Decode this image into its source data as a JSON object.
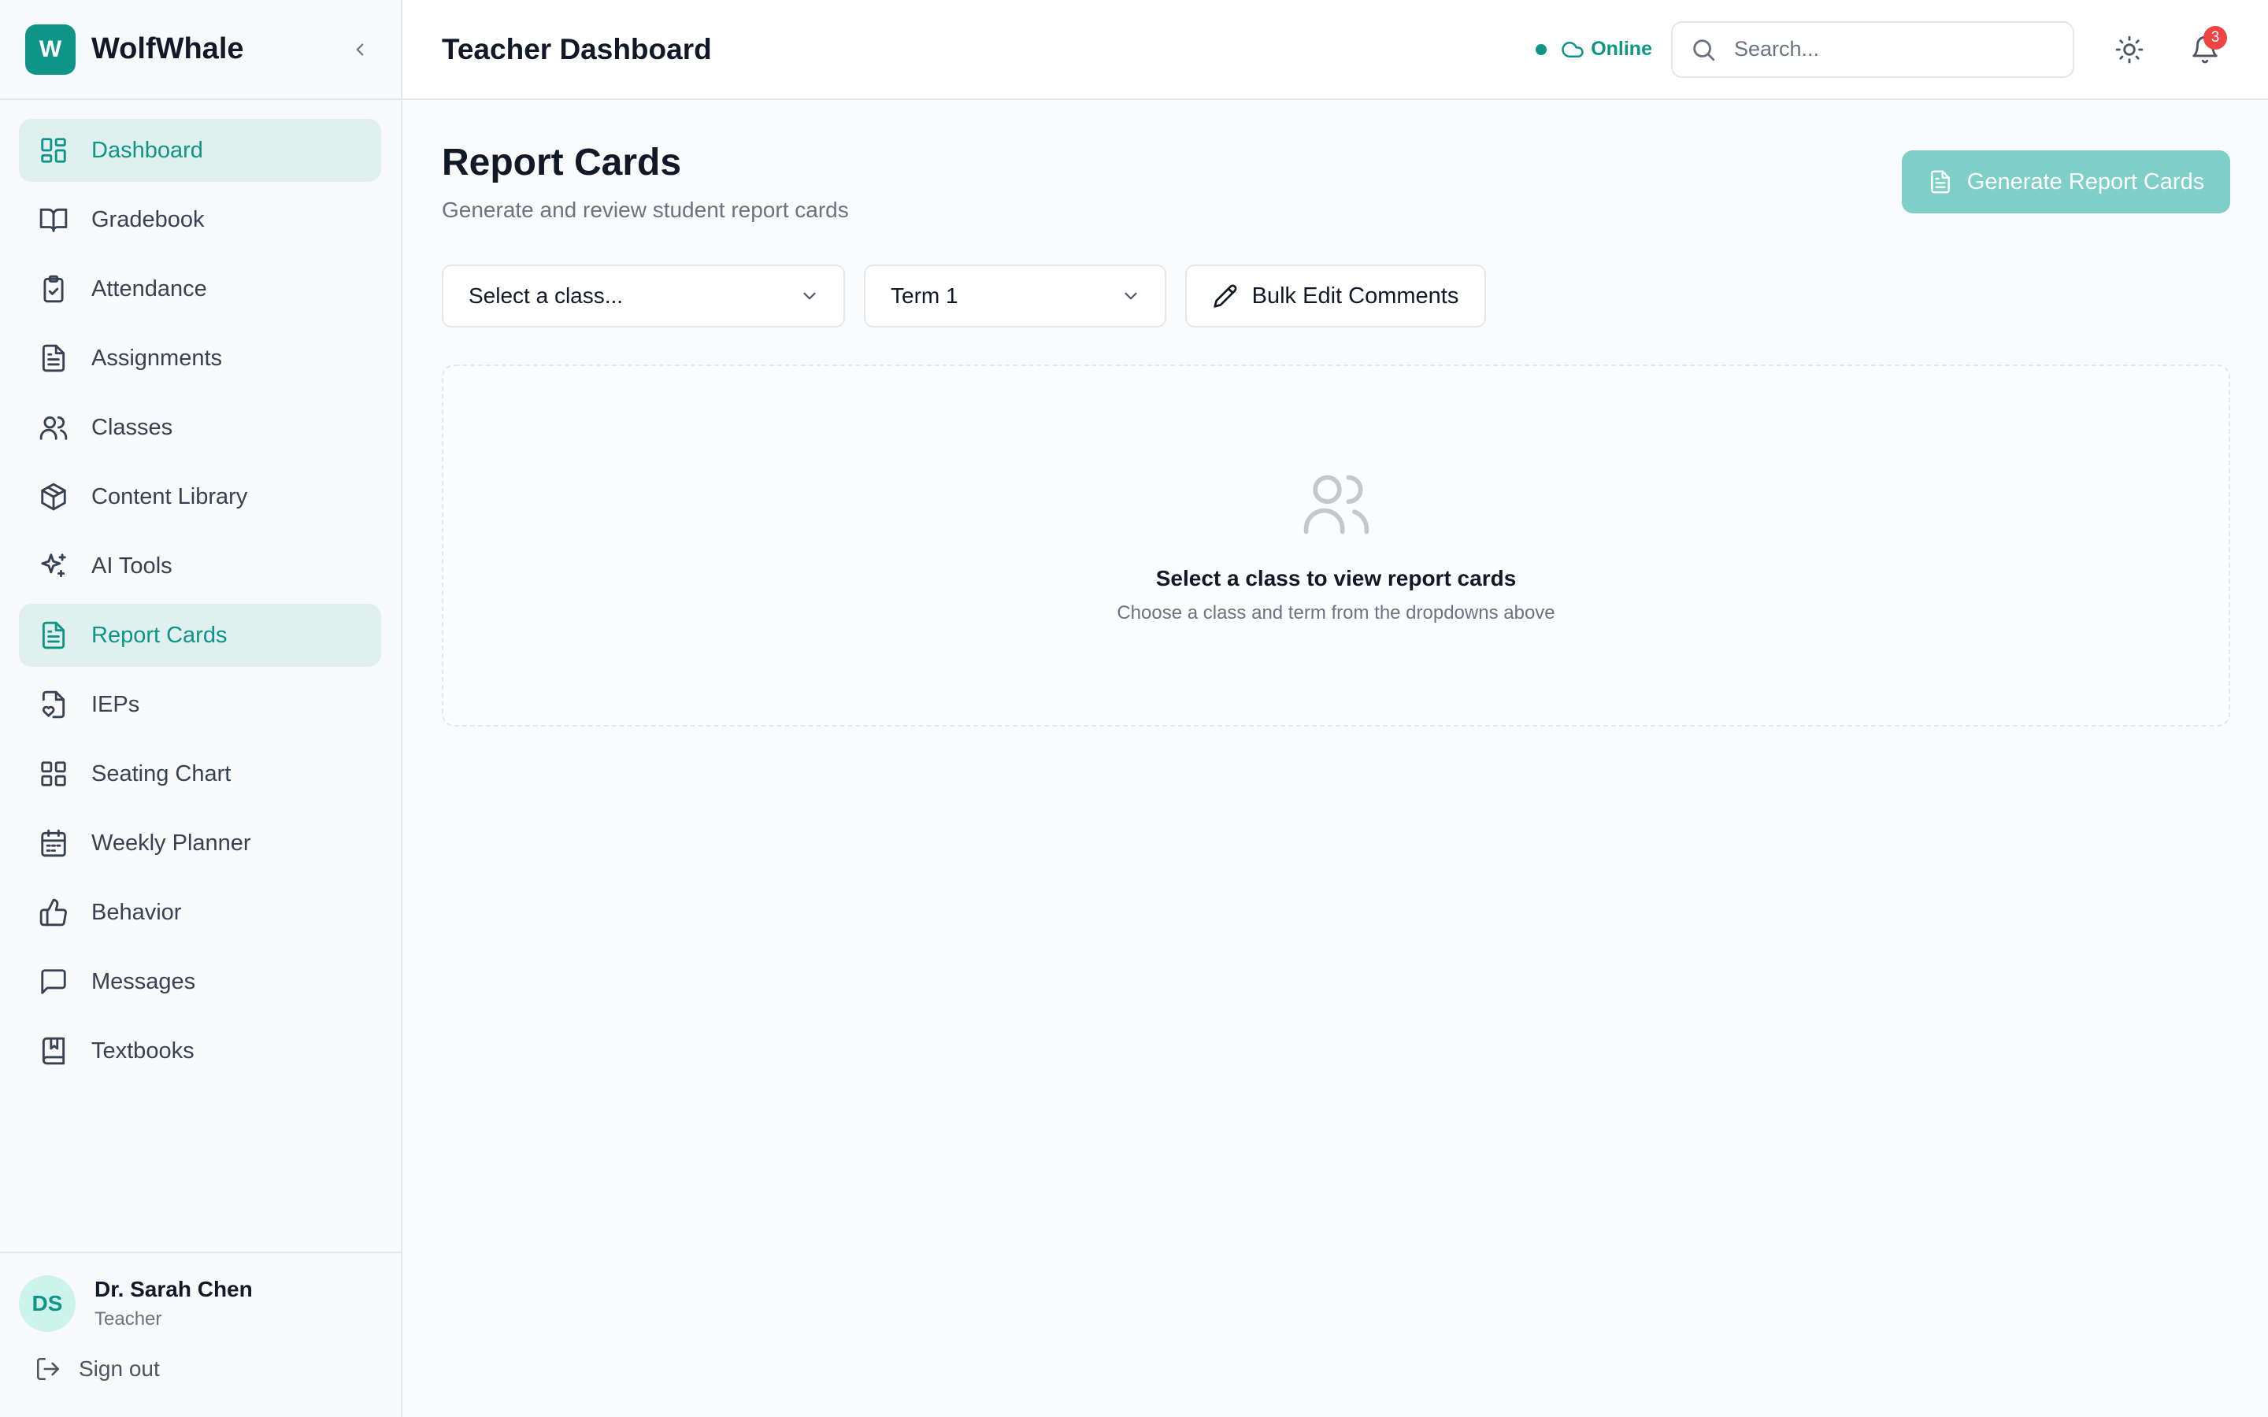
{
  "brand": {
    "logo_letter": "W",
    "name": "WolfWhale"
  },
  "sidebar": {
    "items": [
      {
        "label": "Dashboard",
        "icon": "dashboard-icon",
        "active": true
      },
      {
        "label": "Gradebook",
        "icon": "book-open-icon"
      },
      {
        "label": "Attendance",
        "icon": "clipboard-check-icon"
      },
      {
        "label": "Assignments",
        "icon": "file-text-icon"
      },
      {
        "label": "Classes",
        "icon": "users-icon"
      },
      {
        "label": "Content Library",
        "icon": "package-icon"
      },
      {
        "label": "AI Tools",
        "icon": "sparkles-icon"
      },
      {
        "label": "Report Cards",
        "icon": "file-text-icon",
        "active": true
      },
      {
        "label": "IEPs",
        "icon": "file-heart-icon"
      },
      {
        "label": "Seating Chart",
        "icon": "grid-icon"
      },
      {
        "label": "Weekly Planner",
        "icon": "calendar-icon"
      },
      {
        "label": "Behavior",
        "icon": "thumbs-up-icon"
      },
      {
        "label": "Messages",
        "icon": "message-square-icon"
      },
      {
        "label": "Textbooks",
        "icon": "book-marked-icon"
      }
    ]
  },
  "user": {
    "initials": "DS",
    "name": "Dr. Sarah Chen",
    "role": "Teacher",
    "signout_label": "Sign out"
  },
  "header": {
    "title": "Teacher Dashboard",
    "status": "Online",
    "search_placeholder": "Search...",
    "notification_count": "3"
  },
  "main": {
    "title": "Report Cards",
    "subtitle": "Generate and review student report cards",
    "generate_button": "Generate Report Cards",
    "class_select": "Select a class...",
    "term_select": "Term 1",
    "bulk_edit_button": "Bulk Edit Comments",
    "empty_title": "Select a class to view report cards",
    "empty_subtitle": "Choose a class and term from the dropdowns above"
  },
  "colors": {
    "accent": "#0f9488",
    "accent_light": "#e0f0ef",
    "button_disabled": "#7dcfc7",
    "badge": "#ef4444"
  }
}
